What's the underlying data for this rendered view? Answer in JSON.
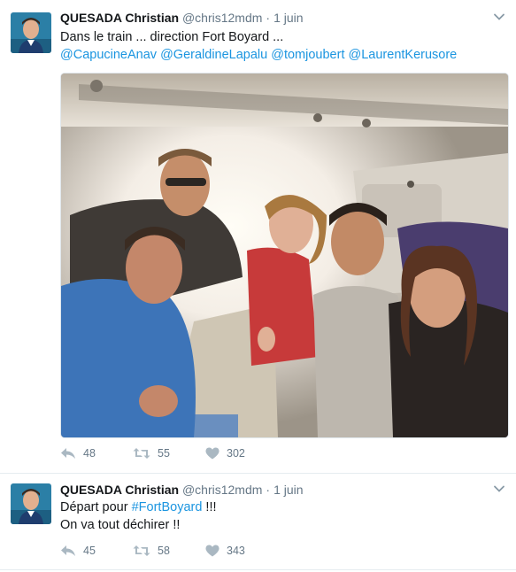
{
  "tweets": [
    {
      "author": {
        "name": "QUESADA Christian",
        "handle": "@chris12mdm"
      },
      "time": "1 juin",
      "text_line1": "Dans le train ... direction Fort Boyard ...",
      "mentions": [
        "@CapucineAnav",
        "@GeraldineLapalu",
        "@tomjoubert",
        "@LaurentKerusore"
      ],
      "stats": {
        "replies": "48",
        "retweets": "55",
        "likes": "302"
      }
    },
    {
      "author": {
        "name": "QUESADA Christian",
        "handle": "@chris12mdm"
      },
      "time": "1 juin",
      "text_line1_prefix": "Départ pour ",
      "hashtag": "#FortBoyard",
      "text_line1_suffix": " !!!",
      "text_line2": "On va tout déchirer !!",
      "stats": {
        "replies": "45",
        "retweets": "58",
        "likes": "343"
      }
    }
  ],
  "icons": {
    "reply": "reply-icon",
    "retweet": "retweet-icon",
    "like": "heart-icon",
    "menu": "chevron-down-icon"
  },
  "colors": {
    "link": "#1b95e0",
    "muted": "#657786",
    "text": "#14171a",
    "divider": "#e6ecf0"
  }
}
